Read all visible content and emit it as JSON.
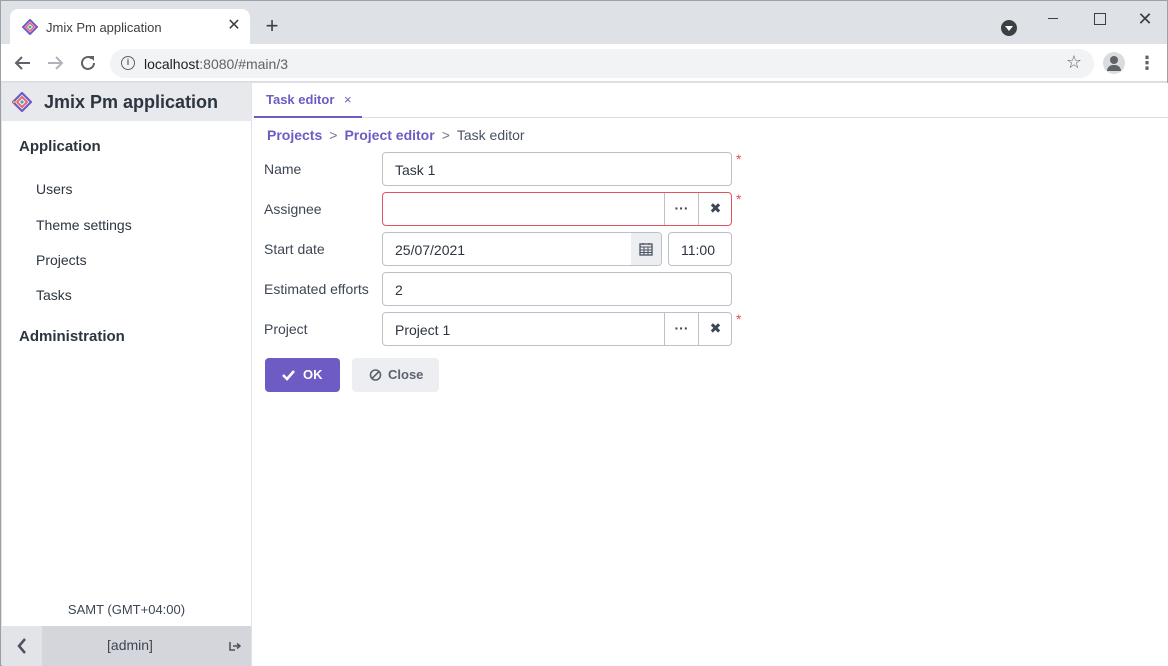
{
  "browser": {
    "tab_title": "Jmix Pm application",
    "tab_close": "✕",
    "new_tab": "+",
    "url_host": "localhost",
    "url_rest": ":8080/#main/3",
    "close_glyph": "✕"
  },
  "app": {
    "title": "Jmix Pm application",
    "accent_color": "#6e5bc4"
  },
  "sidebar": {
    "groups": [
      {
        "label": "Application",
        "items": [
          "Users",
          "Theme settings",
          "Projects",
          "Tasks"
        ]
      },
      {
        "label": "Administration",
        "items": []
      }
    ],
    "timezone": "SAMT (GMT+04:00)",
    "user": "[admin]"
  },
  "main": {
    "tab_label": "Task editor",
    "tab_close": "×",
    "breadcrumb": {
      "link1": "Projects",
      "sep": ">",
      "link2": "Project editor",
      "current": "Task editor"
    },
    "form": {
      "name_label": "Name",
      "name_value": "Task 1",
      "assignee_label": "Assignee",
      "assignee_value": "",
      "start_date_label": "Start date",
      "start_date_value": "25/07/2021",
      "start_time_value": "11:00",
      "efforts_label": "Estimated efforts",
      "efforts_value": "2",
      "project_label": "Project",
      "project_value": "Project 1",
      "required_mark": "*",
      "lookup_glyph": "···",
      "clear_glyph": "✖"
    },
    "buttons": {
      "ok_label": "OK",
      "close_label": "Close"
    }
  }
}
